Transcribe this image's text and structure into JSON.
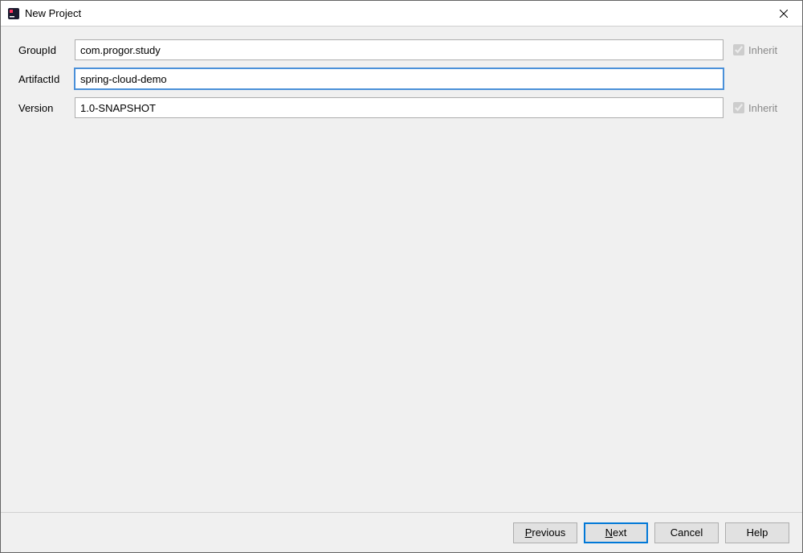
{
  "titlebar": {
    "title": "New Project"
  },
  "form": {
    "groupId": {
      "label": "GroupId",
      "value": "com.progor.study",
      "inherit_label": "Inherit"
    },
    "artifactId": {
      "label": "ArtifactId",
      "value": "spring-cloud-demo"
    },
    "version": {
      "label": "Version",
      "value": "1.0-SNAPSHOT",
      "inherit_label": "Inherit"
    }
  },
  "footer": {
    "previous_mnemonic": "P",
    "previous_rest": "revious",
    "next_mnemonic": "N",
    "next_rest": "ext",
    "cancel": "Cancel",
    "help": "Help"
  }
}
